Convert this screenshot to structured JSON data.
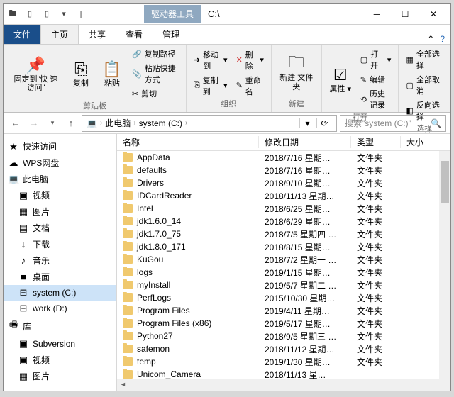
{
  "titlebar": {
    "context_tab": "驱动器工具",
    "title": "C:\\"
  },
  "tabs": {
    "file": "文件",
    "home": "主页",
    "share": "共享",
    "view": "查看",
    "manage": "管理"
  },
  "ribbon": {
    "pin": "固定到\"快\n速访问\"",
    "copy": "复制",
    "paste": "粘贴",
    "copy_path": "复制路径",
    "paste_shortcut": "粘贴快捷方式",
    "cut": "剪切",
    "clipboard_group": "剪贴板",
    "move_to": "移动到",
    "copy_to": "复制到",
    "delete": "删除",
    "rename": "重命名",
    "organize_group": "组织",
    "new_folder": "新建\n文件夹",
    "new_group": "新建",
    "properties": "属性",
    "open": "打开",
    "edit": "编辑",
    "history": "历史记录",
    "open_group": "打开",
    "select_all": "全部选择",
    "select_none": "全部取消",
    "invert": "反向选择",
    "select_group": "选择"
  },
  "breadcrumb": {
    "pc": "此电脑",
    "drive": "system (C:)"
  },
  "search": {
    "placeholder": "搜索\"system (C:)\""
  },
  "columns": {
    "name": "名称",
    "date": "修改日期",
    "type": "类型",
    "size": "大小"
  },
  "sidebar": [
    {
      "icon": "★",
      "label": "快速访问",
      "lvl": 0
    },
    {
      "icon": "☁",
      "label": "WPS网盘",
      "lvl": 0
    },
    {
      "icon": "💻",
      "label": "此电脑",
      "lvl": 0
    },
    {
      "icon": "▣",
      "label": "视频",
      "lvl": 1
    },
    {
      "icon": "▦",
      "label": "图片",
      "lvl": 1
    },
    {
      "icon": "▤",
      "label": "文档",
      "lvl": 1
    },
    {
      "icon": "↓",
      "label": "下载",
      "lvl": 1
    },
    {
      "icon": "♪",
      "label": "音乐",
      "lvl": 1
    },
    {
      "icon": "■",
      "label": "桌面",
      "lvl": 1
    },
    {
      "icon": "⊟",
      "label": "system (C:)",
      "lvl": 1,
      "sel": true
    },
    {
      "icon": "⊟",
      "label": "work (D:)",
      "lvl": 1
    },
    {
      "icon": "🖷",
      "label": "库",
      "lvl": 0
    },
    {
      "icon": "▣",
      "label": "Subversion",
      "lvl": 1
    },
    {
      "icon": "▣",
      "label": "视频",
      "lvl": 1
    },
    {
      "icon": "▦",
      "label": "图片",
      "lvl": 1
    }
  ],
  "files": [
    {
      "name": "AppData",
      "date": "2018/7/16 星期…",
      "type": "文件夹"
    },
    {
      "name": "defaults",
      "date": "2018/7/16 星期…",
      "type": "文件夹"
    },
    {
      "name": "Drivers",
      "date": "2018/9/10 星期…",
      "type": "文件夹"
    },
    {
      "name": "IDCardReader",
      "date": "2018/11/13 星期…",
      "type": "文件夹"
    },
    {
      "name": "Intel",
      "date": "2018/6/25 星期…",
      "type": "文件夹"
    },
    {
      "name": "jdk1.6.0_14",
      "date": "2018/6/29 星期…",
      "type": "文件夹"
    },
    {
      "name": "jdk1.7.0_75",
      "date": "2018/7/5 星期四 …",
      "type": "文件夹"
    },
    {
      "name": "jdk1.8.0_171",
      "date": "2018/8/15 星期…",
      "type": "文件夹"
    },
    {
      "name": "KuGou",
      "date": "2018/7/2 星期一 …",
      "type": "文件夹"
    },
    {
      "name": "logs",
      "date": "2019/1/15 星期…",
      "type": "文件夹"
    },
    {
      "name": "myInstall",
      "date": "2019/5/7 星期二 …",
      "type": "文件夹"
    },
    {
      "name": "PerfLogs",
      "date": "2015/10/30 星期…",
      "type": "文件夹"
    },
    {
      "name": "Program Files",
      "date": "2019/4/11 星期…",
      "type": "文件夹"
    },
    {
      "name": "Program Files (x86)",
      "date": "2019/5/17 星期…",
      "type": "文件夹"
    },
    {
      "name": "Python27",
      "date": "2018/9/5 星期三 …",
      "type": "文件夹"
    },
    {
      "name": "safemon",
      "date": "2018/11/12 星期…",
      "type": "文件夹"
    },
    {
      "name": "temp",
      "date": "2019/1/30 星期…",
      "type": "文件夹"
    },
    {
      "name": "Unicom_Camera",
      "date": "2018/11/13 星…",
      "type": ""
    }
  ]
}
